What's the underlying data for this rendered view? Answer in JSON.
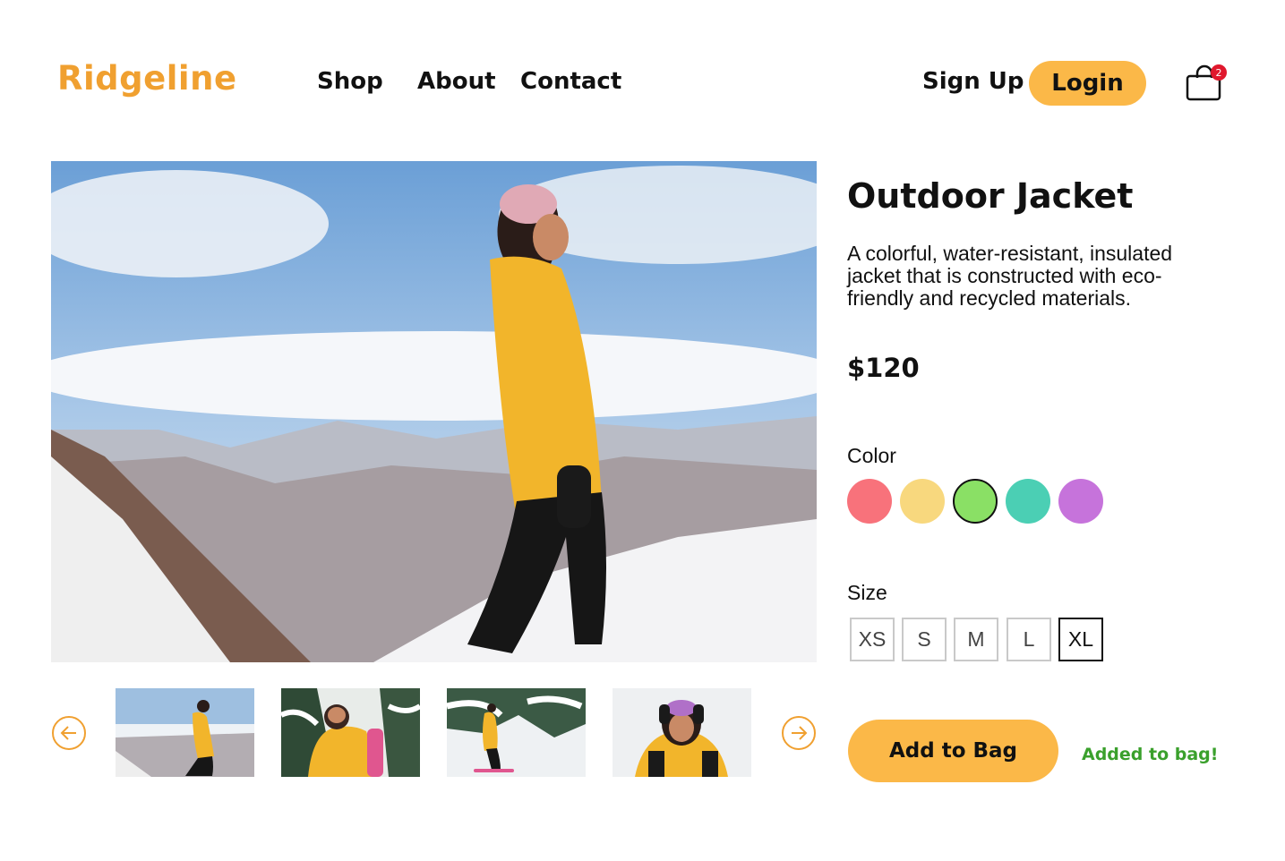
{
  "header": {
    "logo": "Ridgeline",
    "nav": [
      {
        "label": "Shop"
      },
      {
        "label": "About"
      },
      {
        "label": "Contact"
      }
    ],
    "signup_label": "Sign Up",
    "login_label": "Login",
    "cart": {
      "icon": "shopping-bag-icon",
      "count": "2",
      "badge_color": "#e0182d"
    }
  },
  "product": {
    "title": "Outdoor Jacket",
    "description": "A colorful, water-resistant, insulated jacket that is constructed with eco-friendly and recycled materials.",
    "price": "$120",
    "color_label": "Color",
    "colors": [
      {
        "name": "coral",
        "hex": "#f8727b",
        "selected": false
      },
      {
        "name": "yellow",
        "hex": "#f8d87e",
        "selected": false
      },
      {
        "name": "green",
        "hex": "#8ae065",
        "selected": true
      },
      {
        "name": "teal",
        "hex": "#4bcfb4",
        "selected": false
      },
      {
        "name": "purple",
        "hex": "#c673db",
        "selected": false
      }
    ],
    "size_label": "Size",
    "sizes": [
      {
        "label": "XS",
        "selected": false
      },
      {
        "label": "S",
        "selected": false
      },
      {
        "label": "M",
        "selected": false
      },
      {
        "label": "L",
        "selected": false
      },
      {
        "label": "XL",
        "selected": true
      }
    ],
    "add_to_bag_label": "Add to Bag",
    "added_message": "Added to bag!"
  },
  "gallery": {
    "prev_icon": "arrow-left-circle-icon",
    "next_icon": "arrow-right-circle-icon",
    "thumbnails": 4
  },
  "theme": {
    "accent": "#fbb848",
    "logo_color": "#f0a030",
    "success": "#3aa02c"
  }
}
